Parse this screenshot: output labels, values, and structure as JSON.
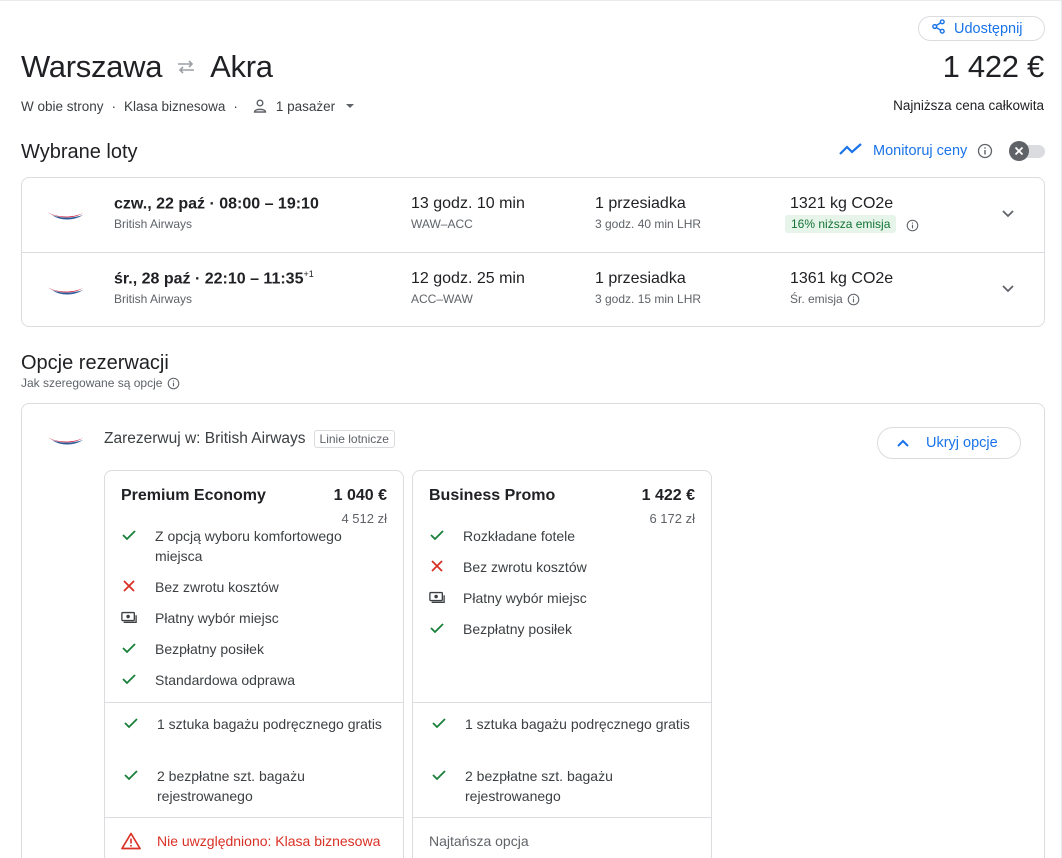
{
  "share": {
    "label": "Udostępnij"
  },
  "trip": {
    "origin": "Warszawa",
    "destination": "Akra",
    "trip_type": "W obie strony",
    "cabin": "Klasa biznesowa",
    "passengers": "1 pasażer",
    "total_price": "1 422 €",
    "price_caption": "Najniższa cena całkowita"
  },
  "selected": {
    "title": "Wybrane loty",
    "monitor_label": "Monitoruj ceny",
    "flights": [
      {
        "date_time": "czw., 22 paź  ·  08:00 – 19:10",
        "superscript": "",
        "airline": "British Airways",
        "duration": "13 godz. 10 min",
        "route": "WAW–ACC",
        "stops": "1 przesiadka",
        "stop_detail": "3 godz. 40 min LHR",
        "co2": "1321 kg CO2e",
        "emission": "16% niższa emisja"
      },
      {
        "date_time": "śr., 28 paź  ·  22:10 – 11:35",
        "superscript": "+1",
        "airline": "British Airways",
        "duration": "12 godz. 25 min",
        "route": "ACC–WAW",
        "stops": "1 przesiadka",
        "stop_detail": "3 godz. 15 min LHR",
        "co2": "1361 kg CO2e",
        "emission": "Śr. emisja"
      }
    ]
  },
  "booking": {
    "title": "Opcje rezerwacji",
    "ranking_note": "Jak szeregowane są opcje",
    "book_with": "Zarezerwuj w: British Airways",
    "chip": "Linie lotnicze",
    "hide_label": "Ukryj opcje",
    "options": [
      {
        "name": "Premium Economy",
        "price_eur": "1 040 €",
        "price_pln": "4 512 zł",
        "features": [
          {
            "icon": "check-icon",
            "text": "Z opcją wyboru komfortowego miejsca"
          },
          {
            "icon": "x-icon",
            "text": "Bez zwrotu kosztów"
          },
          {
            "icon": "money-icon",
            "text": "Płatny wybór miejsc"
          },
          {
            "icon": "check-icon",
            "text": "Bezpłatny posiłek"
          },
          {
            "icon": "check-icon",
            "text": "Standardowa odprawa"
          }
        ],
        "baggage": [
          {
            "icon": "check-icon",
            "text": "1 sztuka bagażu podręcznego gratis"
          },
          {
            "icon": "check-icon",
            "text": "2 bezpłatne szt. bagażu rejestrowanego"
          }
        ],
        "footer": "Nie uwzględniono: Klasa biznesowa"
      },
      {
        "name": "Business Promo",
        "price_eur": "1 422 €",
        "price_pln": "6 172 zł",
        "features": [
          {
            "icon": "check-icon",
            "text": "Rozkładane fotele"
          },
          {
            "icon": "x-icon",
            "text": "Bez zwrotu kosztów"
          },
          {
            "icon": "money-icon",
            "text": "Płatny wybór miejsc"
          },
          {
            "icon": "check-icon",
            "text": "Bezpłatny posiłek"
          }
        ],
        "baggage": [
          {
            "icon": "check-icon",
            "text": "1 sztuka bagażu podręcznego gratis"
          },
          {
            "icon": "check-icon",
            "text": "2 bezpłatne szt. bagażu rejestrowanego"
          }
        ],
        "footer": "Najtańsza opcja"
      }
    ]
  },
  "colors": {
    "accent": "#1a73e8",
    "check": "#188038",
    "cross": "#d93025",
    "eco_bg": "#e6f4ea"
  }
}
